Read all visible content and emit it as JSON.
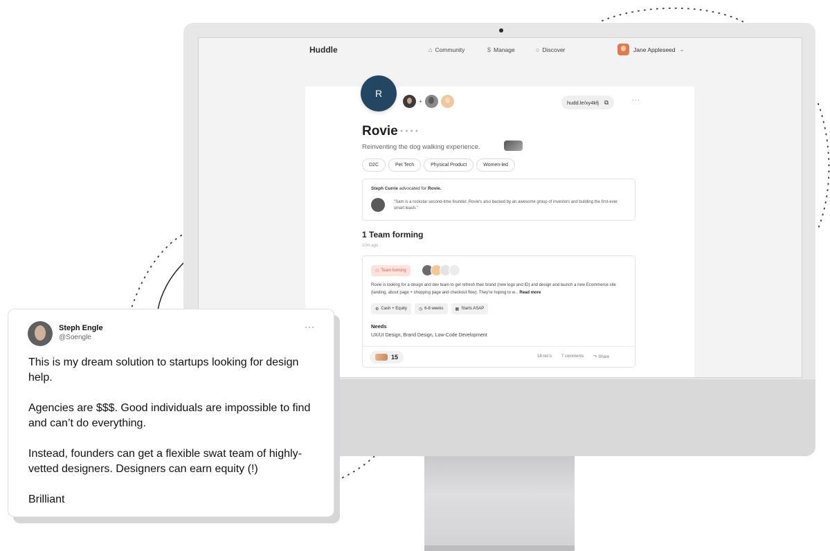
{
  "app": {
    "brand": "Huddle"
  },
  "nav": {
    "items": [
      {
        "label": "Community",
        "icon": "home-icon"
      },
      {
        "label": "Manage",
        "icon": "dollar-icon"
      },
      {
        "label": "Discover",
        "icon": "search-icon"
      }
    ],
    "user_name": "Jane Appleseed"
  },
  "profile": {
    "avatar_letter": "R",
    "link": "hudd.le/xy4kfj",
    "name": "Rovie",
    "tagline": "Reinventing the dog walking experience.",
    "tags": [
      "D2C",
      "Pet Tech",
      "Physical Product",
      "Women-led"
    ]
  },
  "advocate": {
    "name": "Steph Currie",
    "verb": "advocated for",
    "target": "Rovie.",
    "quote": "\"Sam is a rockstar second-time founder. Rovie's also backed by an awesome group of investors and building the first-ever smart leash.\""
  },
  "team": {
    "title": "1 Team forming",
    "ago": "10m ago",
    "badge": "Team forming",
    "description": "Rovie is looking for a design and dev team to get refresh their brand (new logo and ID) and design and launch a new Ecommerce site (landing, about page + shopping page and checkout flow). They're hoping to w...",
    "read_more": "Read more",
    "chips": [
      "Cash + Equity",
      "6-8 weeks",
      "Starts ASAP"
    ],
    "needs_label": "Needs",
    "needs": "UX/UI Design, Brand Design, Low-Code Development",
    "votes": "15",
    "recs": "18 rec's",
    "comments": "7 comments",
    "share": "Share"
  },
  "tweet": {
    "name": "Steph Engle",
    "handle": "@Soengle",
    "paragraphs": [
      "This is my dream solution to startups looking for design help.",
      "Agencies are $$$. Good individuals are impossible to find and can’t do everything.",
      "Instead, founders can get a flexible swat team of highly-vetted designers. Designers can earn equity (!)",
      "Brilliant"
    ]
  },
  "colors": {
    "avatar_blue": "#234763",
    "badge_bg": "#fde3dc",
    "badge_text": "#d9624a"
  }
}
